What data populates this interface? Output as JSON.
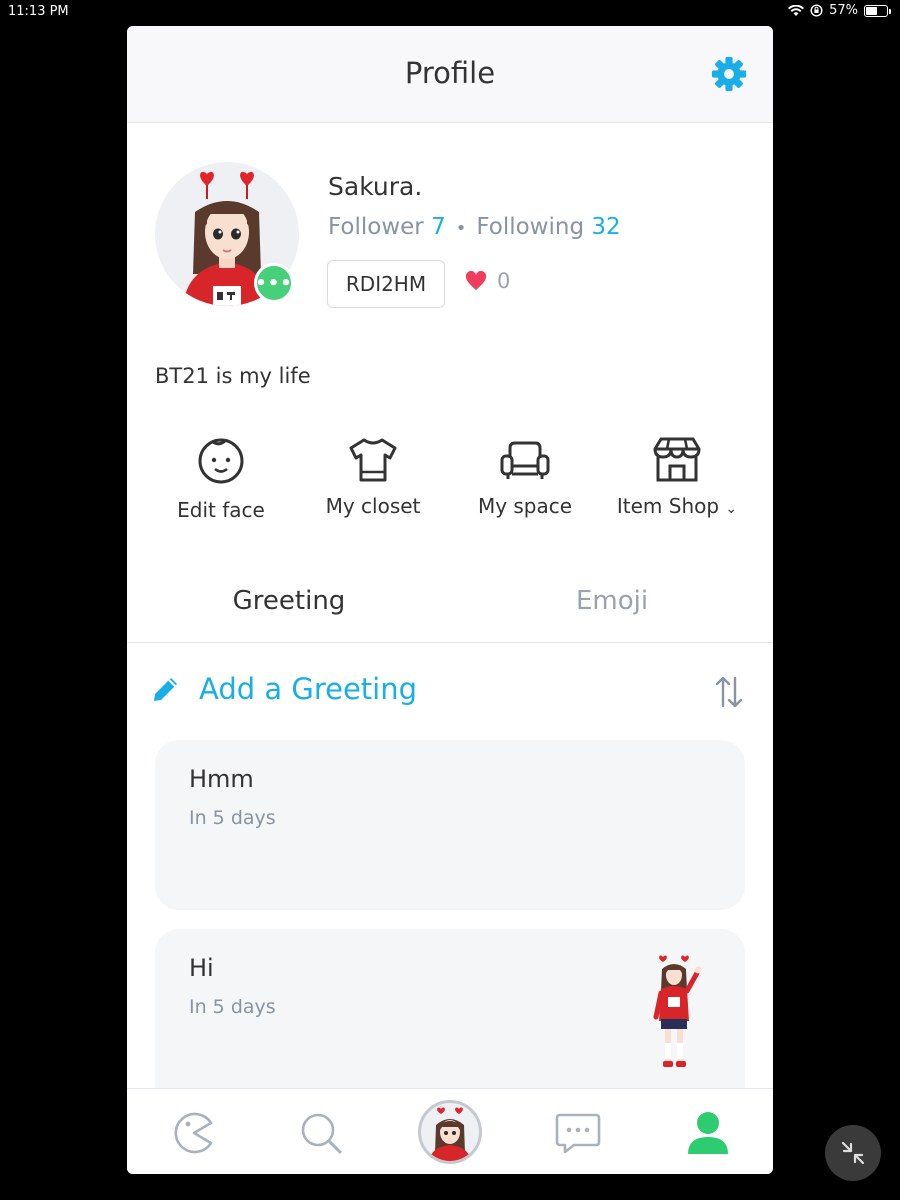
{
  "status_bar": {
    "time": "11:13 PM",
    "battery": "57%",
    "battery_level": 0.57
  },
  "header": {
    "title": "Profile",
    "settings_icon": "gear-icon"
  },
  "profile": {
    "name": "Sakura.",
    "follower_label": "Follower",
    "follower_count": "7",
    "separator": "•",
    "following_label": "Following",
    "following_count": "32",
    "code": "RDI2HM",
    "likes": "0",
    "bio": "BT21 is my life",
    "badge": "•••"
  },
  "actions": [
    {
      "label": "Edit face",
      "icon": "face-icon"
    },
    {
      "label": "My closet",
      "icon": "shirt-icon"
    },
    {
      "label": "My space",
      "icon": "sofa-icon"
    },
    {
      "label": "Item Shop",
      "icon": "shop-icon"
    }
  ],
  "tabs": [
    {
      "label": "Greeting",
      "selected": true
    },
    {
      "label": "Emoji",
      "selected": false
    }
  ],
  "greetings": {
    "add_label": "Add a Greeting",
    "items": [
      {
        "title": "Hmm",
        "subtitle": "In 5 days"
      },
      {
        "title": "Hi",
        "subtitle": "In 5 days"
      }
    ]
  },
  "colors": {
    "accent": "#1aaee8",
    "online": "#47d07a",
    "heart": "#ef3e5c",
    "nav_active": "#2ecc71"
  },
  "bottom_nav": [
    "home-icon",
    "search-icon",
    "avatar-icon",
    "chat-icon",
    "profile-icon"
  ]
}
